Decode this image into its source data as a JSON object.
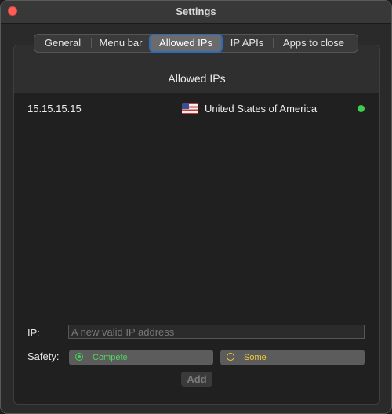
{
  "window": {
    "title": "Settings"
  },
  "tabs": [
    {
      "label": "General"
    },
    {
      "label": "Menu bar"
    },
    {
      "label": "Allowed IPs",
      "active": true
    },
    {
      "label": "IP APIs"
    },
    {
      "label": "Apps to close"
    }
  ],
  "panel": {
    "title": "Allowed IPs"
  },
  "allowed_ips": [
    {
      "ip": "15.15.15.15",
      "flag_icon": "us-flag-icon",
      "country": "United States of America",
      "status_color": "#3fcd4f"
    }
  ],
  "form": {
    "ip_label": "IP:",
    "ip_value": "",
    "ip_placeholder": "A new valid IP address",
    "safety_label": "Safety:",
    "safety_options": [
      {
        "label": "Compete",
        "color": "#4fd85c",
        "selected": true
      },
      {
        "label": "Some",
        "color": "#f1cb3a",
        "selected": false
      }
    ],
    "add_label": "Add"
  }
}
